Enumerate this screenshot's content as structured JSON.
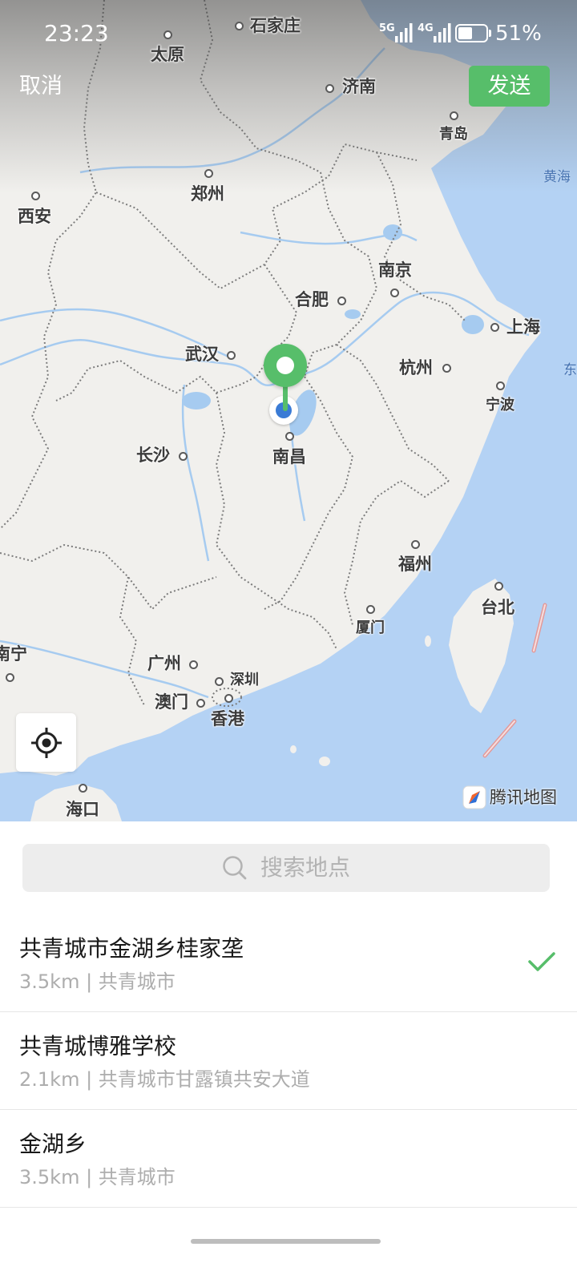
{
  "status_bar": {
    "time": "23:23",
    "network_primary": "5G",
    "network_secondary": "4G",
    "battery_percent": "51%",
    "battery_level": 0.51
  },
  "header": {
    "cancel_label": "取消",
    "send_label": "发送"
  },
  "map": {
    "cities": [
      "石家庄",
      "太原",
      "济南",
      "青岛",
      "郑州",
      "西安",
      "南京",
      "合肥",
      "上海",
      "武汉",
      "杭州",
      "宁波",
      "长沙",
      "南昌",
      "福州",
      "台北",
      "厦门",
      "南宁",
      "广州",
      "深圳",
      "澳门",
      "香港",
      "海口"
    ],
    "seas": [
      "黄海",
      "东"
    ],
    "provider_logo_text": "腾讯地图",
    "locate_icon": "crosshair-icon",
    "pin_icon": "map-pin-icon"
  },
  "search": {
    "placeholder": "搜索地点",
    "icon": "search-icon"
  },
  "results": {
    "separator": " | ",
    "selected_icon": "check-icon",
    "items": [
      {
        "title": "共青城市金湖乡桂家垄",
        "distance": "3.5km",
        "address": "共青城市",
        "selected": true
      },
      {
        "title": "共青城博雅学校",
        "distance": "2.1km",
        "address": "共青城市甘露镇共安大道",
        "selected": false
      },
      {
        "title": "金湖乡",
        "distance": "3.5km",
        "address": "共青城市",
        "selected": false
      }
    ]
  },
  "colors": {
    "accent": "#57be6a",
    "user_location": "#3a7bd5"
  }
}
